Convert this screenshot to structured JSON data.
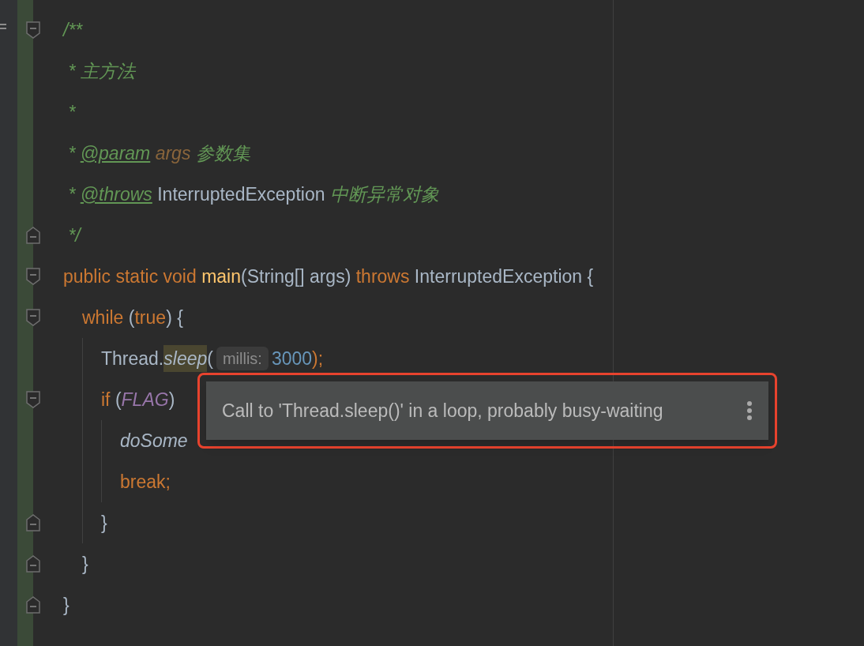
{
  "code": [
    {
      "kind": "opener",
      "tokens": [
        {
          "text": "/**",
          "kind": "comment"
        }
      ]
    },
    {
      "kind": "line",
      "tokens": [
        {
          "text": " * 主方法",
          "kind": "comment"
        }
      ]
    },
    {
      "kind": "line",
      "tokens": [
        {
          "text": " *",
          "kind": "comment"
        }
      ]
    },
    {
      "kind": "line",
      "tokens": [
        {
          "text": " * ",
          "kind": "comment"
        },
        {
          "text": "@param",
          "kind": "tag"
        },
        {
          "text": " args",
          "kind": "param"
        },
        {
          "text": " 参数集",
          "kind": "comment"
        }
      ]
    },
    {
      "kind": "line",
      "tokens": [
        {
          "text": " * ",
          "kind": "comment"
        },
        {
          "text": "@throws",
          "kind": "tag"
        },
        {
          "text": " InterruptedException",
          "kind": "plain"
        },
        {
          "text": " 中断异常对象",
          "kind": "comment"
        }
      ]
    },
    {
      "kind": "closer",
      "tokens": [
        {
          "text": " */",
          "kind": "comment"
        }
      ]
    },
    {
      "kind": "opener",
      "tokens": [
        {
          "text": "public static void ",
          "kind": "keyword"
        },
        {
          "text": "main",
          "kind": "decl"
        },
        {
          "text": "(String[] args) ",
          "kind": "plain"
        },
        {
          "text": "throws ",
          "kind": "keyword"
        },
        {
          "text": "InterruptedException {",
          "kind": "plain"
        }
      ],
      "children": [
        {
          "kind": "opener",
          "tokens": [
            {
              "text": "while ",
              "kind": "keyword"
            },
            {
              "text": "(",
              "kind": "plain"
            },
            {
              "text": "true",
              "kind": "keyword"
            },
            {
              "text": ") {",
              "kind": "plain"
            }
          ],
          "children": [
            {
              "kind": "line",
              "tokens": [
                {
                  "text": "Thread.",
                  "kind": "plain"
                },
                {
                  "text": "sleep",
                  "kind": "warn"
                },
                {
                  "text": "(",
                  "kind": "plain"
                },
                {
                  "text": "millis:",
                  "kind": "hint"
                },
                {
                  "text": "3000",
                  "kind": "number"
                },
                {
                  "text": ");",
                  "kind": "keyword"
                }
              ]
            },
            {
              "kind": "opener",
              "tokens": [
                {
                  "text": "if ",
                  "kind": "keyword"
                },
                {
                  "text": "(",
                  "kind": "plain"
                },
                {
                  "text": "FLAG",
                  "kind": "const"
                },
                {
                  "text": ")",
                  "kind": "plain"
                }
              ],
              "children": [
                {
                  "kind": "line",
                  "tokens": [
                    {
                      "text": "doSome",
                      "kind": "call"
                    }
                  ]
                },
                {
                  "kind": "line",
                  "tokens": [
                    {
                      "text": "break;",
                      "kind": "keyword"
                    }
                  ]
                }
              ],
              "closing": {
                "kind": "closer",
                "tokens": [
                  {
                    "text": "}",
                    "kind": "plain"
                  }
                ]
              }
            }
          ],
          "closing": {
            "kind": "closer",
            "tokens": [
              {
                "text": "}",
                "kind": "plain"
              }
            ]
          }
        }
      ],
      "closing": {
        "kind": "closer",
        "tokens": [
          {
            "text": "}",
            "kind": "plain"
          }
        ]
      }
    }
  ],
  "tooltip": {
    "text": "Call to 'Thread.sleep()' in a loop, probably busy-waiting",
    "highlighted": true
  }
}
